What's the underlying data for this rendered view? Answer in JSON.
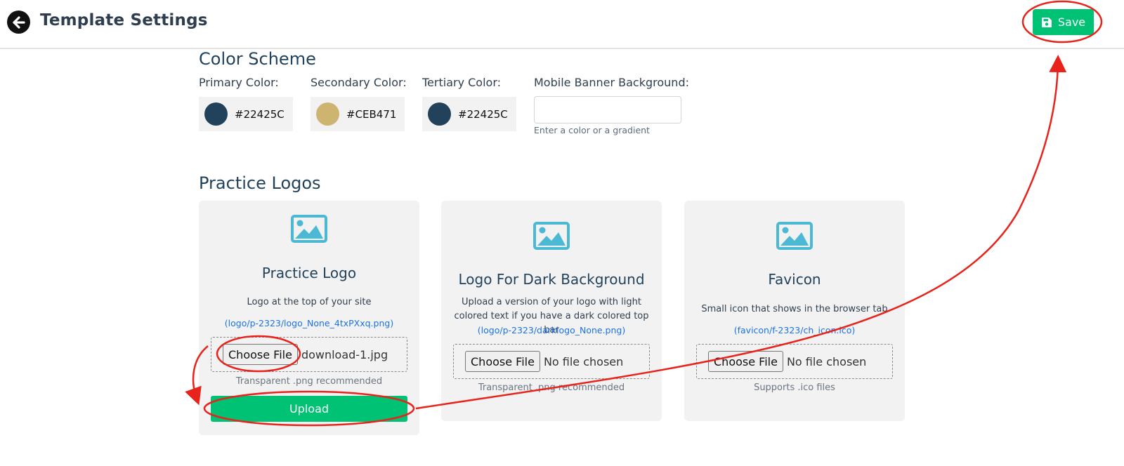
{
  "header": {
    "title": "Template Settings",
    "save_label": "Save",
    "accent": "#00C274"
  },
  "color_scheme": {
    "title": "Color Scheme",
    "primary": {
      "label": "Primary Color:",
      "value": "#22425C"
    },
    "secondary": {
      "label": "Secondary Color:",
      "value": "#CEB471"
    },
    "tertiary": {
      "label": "Tertiary Color:",
      "value": "#22425C"
    },
    "mobile_banner": {
      "label": "Mobile Banner Background:",
      "value": "",
      "hint": "Enter a color or a gradient"
    }
  },
  "logos": {
    "title": "Practice Logos",
    "cards": [
      {
        "title": "Practice Logo",
        "desc": "Logo at the top of your site",
        "link": "(logo/p-2323/logo_None_4txPXxq.png)",
        "choose_label": "Choose File",
        "file_name": "download-1.jpg",
        "note": "Transparent .png recommended",
        "upload_label": "Upload"
      },
      {
        "title": "Logo For Dark Background",
        "desc": "Upload a version of your logo with light colored text if you have a dark colored top bar",
        "link": "(logo/p-2323/darklogo_None.png)",
        "choose_label": "Choose File",
        "file_name": "No file chosen",
        "note": "Transparent .png recommended"
      },
      {
        "title": "Favicon",
        "desc": "Small icon that shows in the browser tab",
        "link": "(favicon/f-2323/ch_icon.ico)",
        "choose_label": "Choose File",
        "file_name": "No file chosen",
        "note": "Supports .ico files"
      }
    ]
  },
  "icons": {
    "back": "arrow-left-circle-icon",
    "save": "floppy-disk-icon",
    "image": "image-placeholder-icon",
    "image_color": "#4bb8d4"
  },
  "annotation_color": "#e8231b"
}
